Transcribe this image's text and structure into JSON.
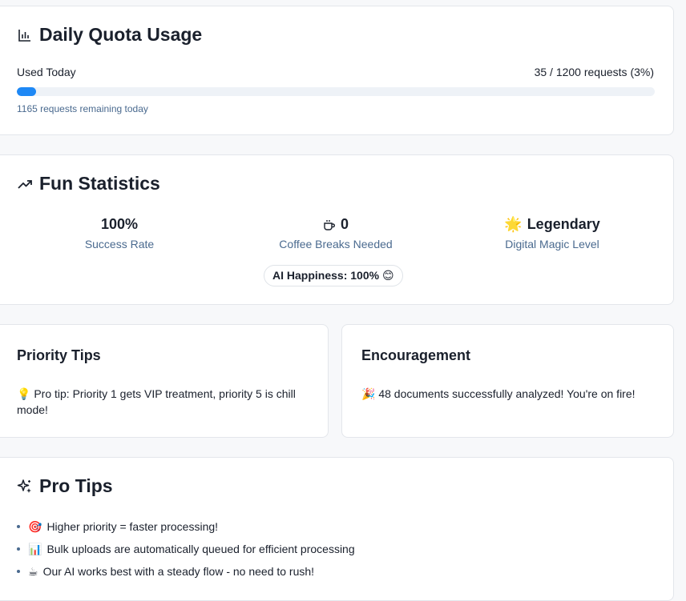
{
  "quota": {
    "title": "Daily Quota Usage",
    "icon": "bar-chart-icon",
    "used_label": "Used Today",
    "used_value": "35 / 1200 requests (3%)",
    "progress_percent": 3,
    "remaining": "1165 requests remaining today",
    "accent": "#1e88f5"
  },
  "fun": {
    "title": "Fun Statistics",
    "icon": "trending-up-icon",
    "stats": [
      {
        "value": "100%",
        "label": "Success Rate",
        "icon": ""
      },
      {
        "value": "0",
        "label": "Coffee Breaks Needed",
        "icon": "coffee-cup-icon"
      },
      {
        "value": "Legendary",
        "label": "Digital Magic Level",
        "icon": "🌟"
      }
    ],
    "pill": "AI Happiness: 100% 😊"
  },
  "priority_tips": {
    "title": "Priority Tips",
    "text": "💡 Pro tip: Priority 1 gets VIP treatment, priority 5 is chill mode!"
  },
  "encouragement": {
    "title": "Encouragement",
    "text": "🎉 48 documents successfully analyzed! You're on fire!"
  },
  "pro_tips": {
    "title": "Pro Tips",
    "icon": "sparkles-icon",
    "items": [
      {
        "emoji": "🎯",
        "text": "Higher priority = faster processing!"
      },
      {
        "emoji": "📊",
        "text": "Bulk uploads are automatically queued for efficient processing"
      },
      {
        "emoji": "☕",
        "text": "Our AI works best with a steady flow - no need to rush!"
      }
    ]
  }
}
